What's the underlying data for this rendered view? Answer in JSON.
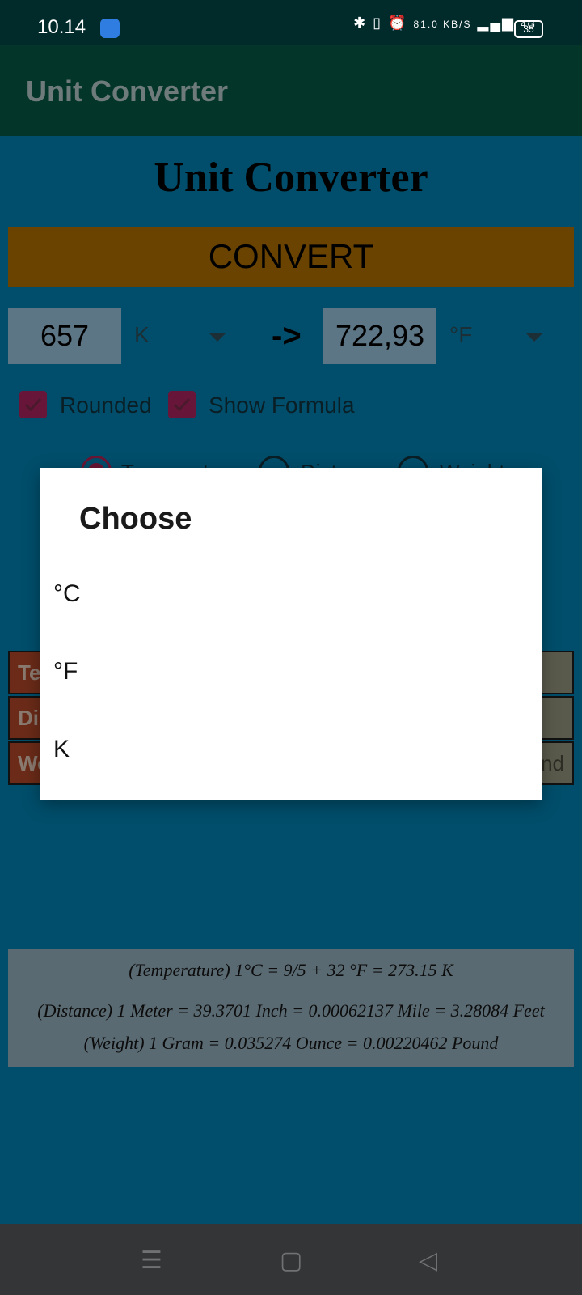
{
  "status": {
    "time": "10.14",
    "net_speed": "81.0 KB/S",
    "signal": "4G",
    "battery": "35"
  },
  "appbar": {
    "title": "Unit Converter"
  },
  "main": {
    "title": "Unit Converter",
    "convert_label": "CONVERT",
    "from_value": "657",
    "from_unit": "K",
    "arrow": "->",
    "to_value": "722,93",
    "to_unit": "°F",
    "rounded_label": "Rounded",
    "show_formula_label": "Show Formula",
    "radios": [
      {
        "label": "Temperature",
        "selected": true
      },
      {
        "label": "Distance",
        "selected": false
      },
      {
        "label": "Weight",
        "selected": false
      }
    ],
    "table_rows": [
      {
        "header": "Te",
        "cell": ""
      },
      {
        "header": "Dis",
        "cell": ""
      },
      {
        "header": "We",
        "cell": "nd"
      }
    ],
    "formulas": [
      "(Temperature) 1°C = 9/5 + 32 °F = 273.15 K",
      "(Distance) 1 Meter = 39.3701 Inch = 0.00062137 Mile = 3.28084 Feet",
      "(Weight) 1 Gram = 0.035274 Ounce = 0.00220462 Pound"
    ]
  },
  "dialog": {
    "title": "Choose",
    "options": [
      "°C",
      "°F",
      "K"
    ]
  },
  "navbar": {
    "icons": [
      "menu-icon",
      "home-icon",
      "back-icon"
    ]
  }
}
